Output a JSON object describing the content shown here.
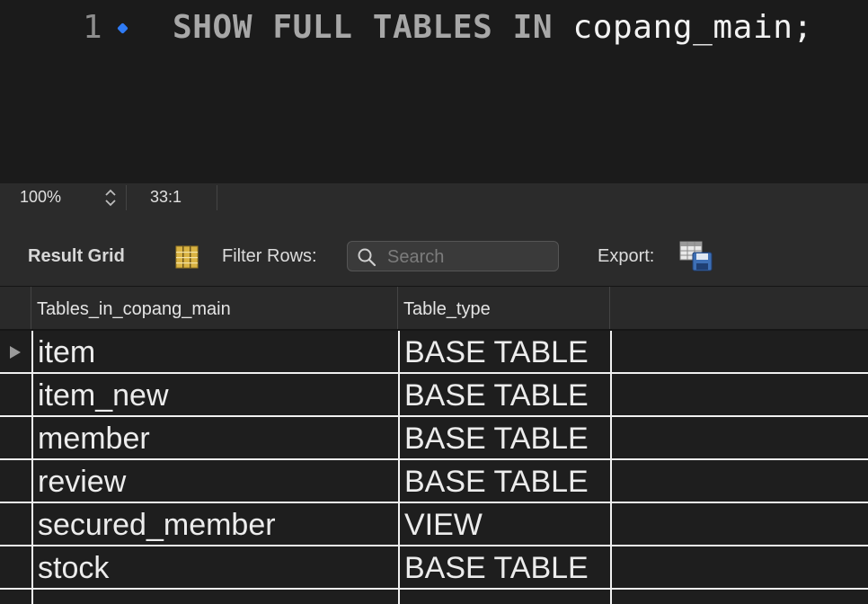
{
  "editor": {
    "line_number": "1",
    "code_keywords": "SHOW FULL TABLES IN",
    "code_identifier": "copang_main;"
  },
  "status_bar": {
    "zoom": "100%",
    "cursor_position": "33:1"
  },
  "toolbar": {
    "result_grid_label": "Result Grid",
    "filter_rows_label": "Filter Rows:",
    "search_placeholder": "Search",
    "export_label": "Export:"
  },
  "result": {
    "columns": [
      "Tables_in_copang_main",
      "Table_type"
    ],
    "rows": [
      {
        "name": "item",
        "type": "BASE TABLE",
        "current": true
      },
      {
        "name": "item_new",
        "type": "BASE TABLE"
      },
      {
        "name": "member",
        "type": "BASE TABLE"
      },
      {
        "name": "review",
        "type": "BASE TABLE"
      },
      {
        "name": "secured_member",
        "type": "VIEW"
      },
      {
        "name": "stock",
        "type": "BASE TABLE"
      }
    ]
  },
  "colors": {
    "editor_bg": "#1b1b1b",
    "panel_bg": "#2b2b2b",
    "exec_marker": "#2f7bf5",
    "grid_line": "#f0f0f0"
  },
  "icons": {
    "exec": "current-statement-marker-icon",
    "zoom": "stepper-icon",
    "grid": "result-grid-icon",
    "search": "search-icon",
    "export": "export-icon",
    "row": "current-row-arrow-icon"
  }
}
